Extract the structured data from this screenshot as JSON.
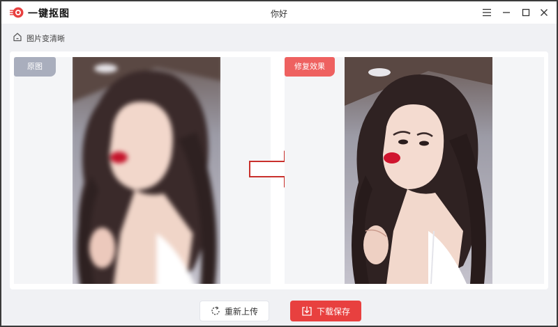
{
  "app": {
    "name": "一键抠图",
    "window_title": "你好"
  },
  "window_controls": {
    "menu_icon": "menu-icon",
    "minimize_icon": "minimize-icon",
    "maximize_icon": "maximize-icon",
    "close_icon": "close-icon"
  },
  "breadcrumb": {
    "icon": "home-icon",
    "label": "图片变清晰"
  },
  "compare": {
    "original_tag": "原图",
    "result_tag": "修复效果",
    "arrow_icon": "right-arrow-icon"
  },
  "actions": {
    "reupload_label": "重新上传",
    "reupload_icon": "refresh-icon",
    "download_label": "下载保存",
    "download_icon": "download-icon"
  },
  "colors": {
    "accent": "#e8403f",
    "original_tag": "#a9aebd",
    "result_tag": "#ee6160",
    "arrow_outline": "#c9302c"
  }
}
